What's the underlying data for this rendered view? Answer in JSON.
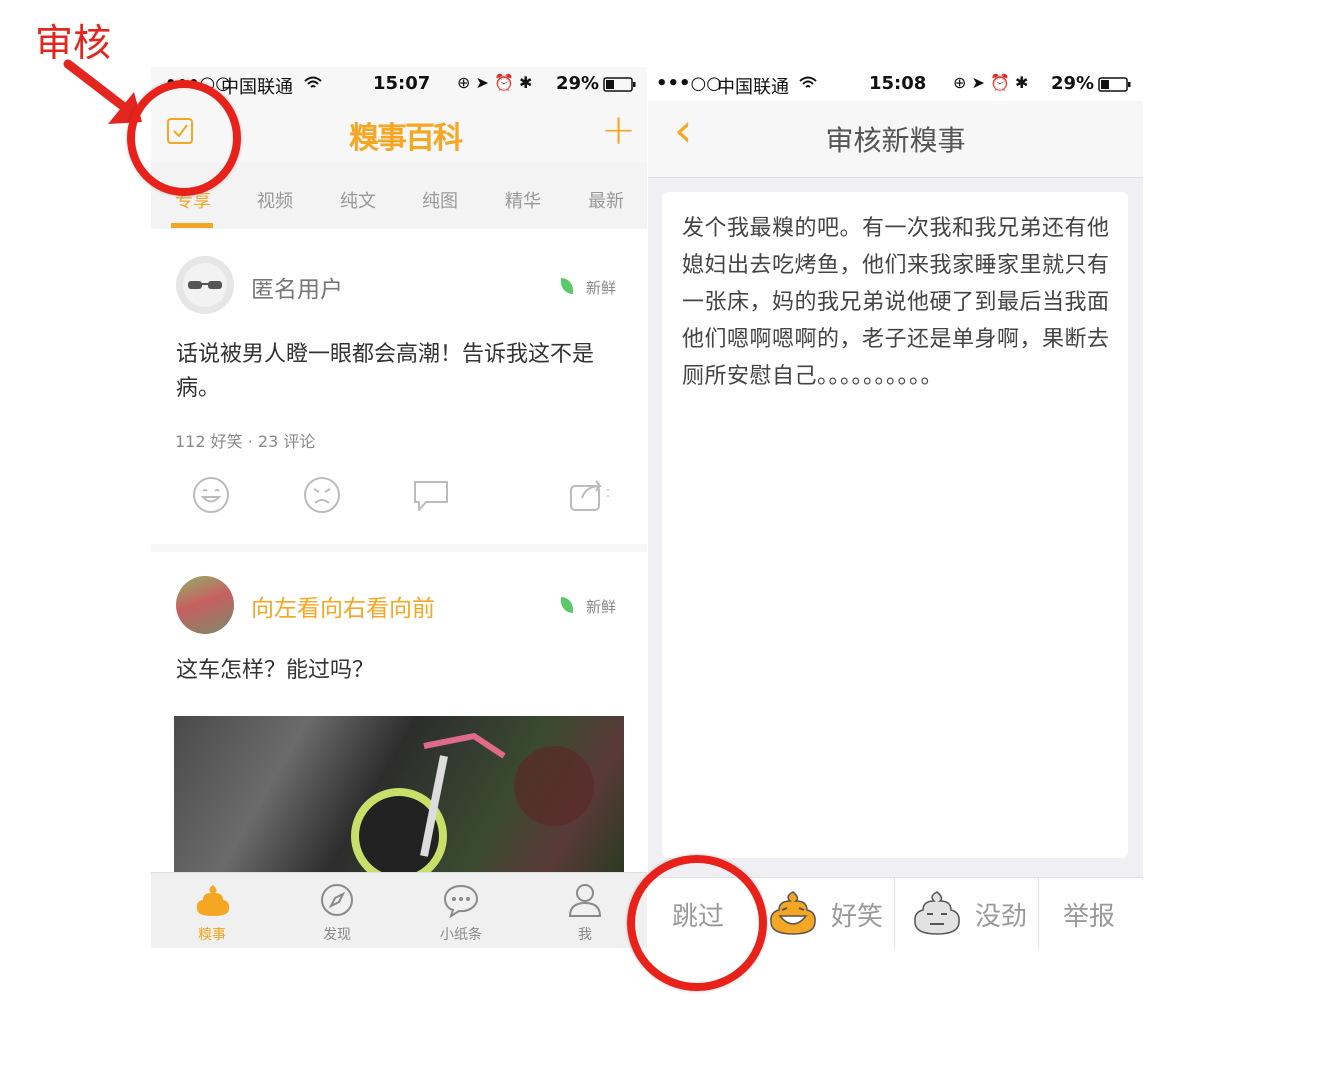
{
  "annotation": {
    "label": "审核"
  },
  "left_phone": {
    "status": {
      "signal": "•••○○",
      "carrier": "中国联通",
      "time": "15:07",
      "battery": "29%"
    },
    "nav": {
      "logo": "糗事百科",
      "add": "+"
    },
    "tabs": [
      "专享",
      "视频",
      "纯文",
      "纯图",
      "精华",
      "最新"
    ],
    "active_tab": "专享",
    "posts": [
      {
        "user": "匿名用户",
        "badge": "新鲜",
        "content": "话说被男人瞪一眼都会高潮！告诉我这不是病。",
        "stats": "112 好笑 · 23 评论"
      },
      {
        "user": "向左看向右看向前",
        "badge": "新鲜",
        "content": "这车怎样？能过吗？"
      }
    ],
    "bottom_tabs": [
      "糗事",
      "发现",
      "小纸条",
      "我"
    ],
    "active_bottom": "糗事"
  },
  "right_phone": {
    "status": {
      "signal": "•••○○",
      "carrier": "中国联通",
      "time": "15:08",
      "battery": "29%"
    },
    "title": "审核新糗事",
    "back": "‹",
    "text": "发个我最糗的吧。有一次我和我兄弟还有他媳妇出去吃烤鱼，他们来我家睡家里就只有一张床，妈的我兄弟说他硬了到最后当我面他们嗯啊嗯啊的，老子还是单身啊，果断去厕所安慰自己。。。。。。。。。。",
    "actions": {
      "skip": "跳过",
      "funny": "好笑",
      "boring": "没劲",
      "report": "举报"
    }
  },
  "colors": {
    "accent": "#f5a623",
    "annotation": "#e8221a",
    "fresh": "#5cc96b"
  }
}
